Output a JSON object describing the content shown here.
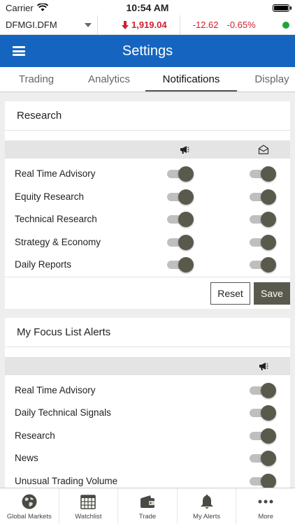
{
  "status": {
    "carrier": "Carrier",
    "time": "10:54 AM"
  },
  "ticker": {
    "symbol": "DFMGI.DFM",
    "price": "1,919.04",
    "change": "-12.62",
    "percent": "-0.65%",
    "down_color": "#d0202e",
    "live_color": "#22a33a"
  },
  "header": {
    "title": "Settings",
    "bg_color": "#1565c0"
  },
  "tabs": [
    {
      "label": "Trading"
    },
    {
      "label": "Analytics"
    },
    {
      "label": "Notifications",
      "active": true
    },
    {
      "label": "Display"
    }
  ],
  "research": {
    "title": "Research",
    "col_icons": [
      "megaphone-icon",
      "envelope-open-icon"
    ],
    "rows": [
      {
        "label": "Real Time Advisory",
        "push": true,
        "email": true
      },
      {
        "label": "Equity Research",
        "push": true,
        "email": true
      },
      {
        "label": "Technical Research",
        "push": true,
        "email": true
      },
      {
        "label": "Strategy & Economy",
        "push": true,
        "email": true
      },
      {
        "label": "Daily Reports",
        "push": true,
        "email": true
      }
    ],
    "reset_label": "Reset",
    "save_label": "Save"
  },
  "focus": {
    "title": "My Focus List Alerts",
    "col_icons": [
      "megaphone-icon"
    ],
    "rows": [
      {
        "label": "Real Time Advisory",
        "push": true
      },
      {
        "label": "Daily Technical Signals",
        "push": true
      },
      {
        "label": "Research",
        "push": true
      },
      {
        "label": "News",
        "push": true
      },
      {
        "label": "Unusual Trading Volume",
        "push": true
      }
    ]
  },
  "bottom_nav": [
    {
      "label": "Global Markets",
      "icon": "globe-icon"
    },
    {
      "label": "Watchlist",
      "icon": "calendar-grid-icon"
    },
    {
      "label": "Trade",
      "icon": "wallet-icon"
    },
    {
      "label": "My Alerts",
      "icon": "bell-icon"
    },
    {
      "label": "More",
      "icon": "more-dots-icon"
    }
  ]
}
